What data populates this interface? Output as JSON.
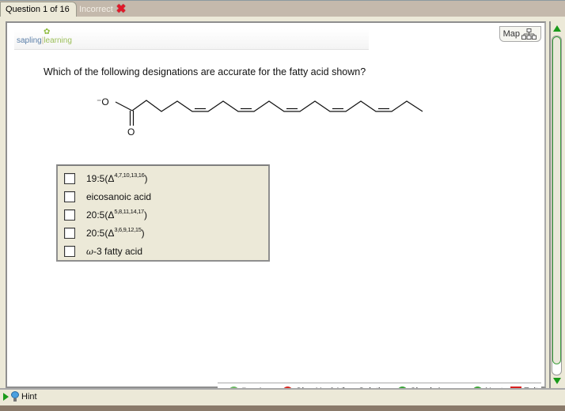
{
  "tabs": {
    "question_label": "Question 1 of 16",
    "status_label": "Incorrect",
    "status_icon": "red-x-icon"
  },
  "logo": {
    "part1": "sapling",
    "part2": "learning"
  },
  "map_button": {
    "label": "Map",
    "icon": "sitemap-icon"
  },
  "question": {
    "text": "Which of the following designations are accurate for the fatty acid shown?",
    "molecule": {
      "carboxylate_o_minus": "⁻O",
      "carbonyl_o": "O",
      "description": "20-carbon carboxylate with 5 cis double bonds"
    }
  },
  "answers": [
    {
      "prefix": "19:5(Δ",
      "sup": "4,7,10,13,16",
      "suffix": ")",
      "checked": false
    },
    {
      "prefix": "eicosanoic acid",
      "sup": "",
      "suffix": "",
      "checked": false
    },
    {
      "prefix": "20:5(Δ",
      "sup": "5,8,11,14,17",
      "suffix": ")",
      "checked": false
    },
    {
      "prefix": "20:5(Δ",
      "sup": "3,6,9,12,15",
      "suffix": ")",
      "checked": false
    },
    {
      "omega": "ω",
      "prefix": "-3 fatty acid",
      "sup": "",
      "suffix": "",
      "checked": false
    }
  ],
  "nav": {
    "previous": "Previous",
    "give_up": "Give Up & View Solution",
    "check": "Check Answer",
    "next": "Next",
    "exit": "Exit"
  },
  "hint": {
    "label": "Hint"
  },
  "colors": {
    "accent_green": "#1a9a1a",
    "incorrect_red": "#e0182a",
    "panel_bg": "#ece9d8",
    "chrome_bg": "#c4b9ac"
  }
}
